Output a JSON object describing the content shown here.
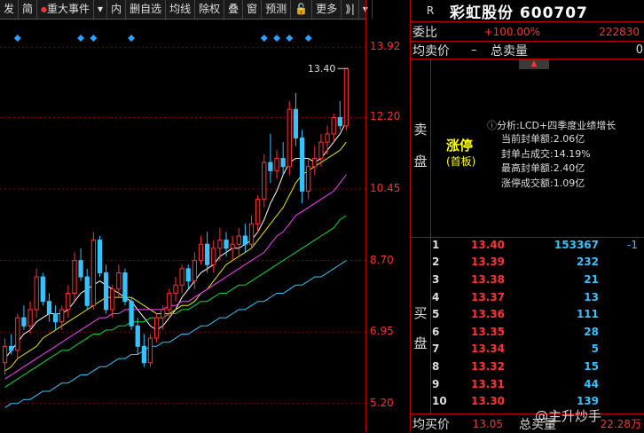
{
  "toolbar": {
    "items": [
      "发",
      "简",
      "重大事件",
      "▾",
      "内",
      "删自选",
      "均线",
      "除权",
      "叠",
      "窗",
      "预测",
      "🔓",
      "更多",
      "⟫|",
      "▾"
    ]
  },
  "chart_data": {
    "type": "candlestick",
    "y_ticks": [
      "13.92",
      "12.20",
      "10.45",
      "8.70",
      "6.95",
      "5.20"
    ],
    "ylim": [
      4.5,
      14.6
    ],
    "last_price_label": "13.40",
    "candles": [
      [
        6.2,
        6.8,
        5.9,
        6.6
      ],
      [
        6.6,
        6.9,
        6.4,
        6.5
      ],
      [
        6.5,
        7.4,
        6.3,
        7.3
      ],
      [
        7.3,
        7.6,
        7.0,
        7.1
      ],
      [
        7.1,
        7.7,
        6.9,
        7.5
      ],
      [
        7.5,
        8.5,
        7.3,
        8.3
      ],
      [
        8.3,
        8.4,
        7.6,
        7.7
      ],
      [
        7.7,
        7.9,
        7.2,
        7.4
      ],
      [
        7.4,
        7.6,
        7.0,
        7.2
      ],
      [
        7.2,
        7.6,
        7.0,
        7.5
      ],
      [
        7.5,
        8.1,
        7.3,
        7.9
      ],
      [
        7.9,
        8.9,
        7.7,
        8.7
      ],
      [
        8.7,
        9.0,
        8.2,
        8.3
      ],
      [
        8.3,
        8.5,
        7.5,
        7.6
      ],
      [
        7.6,
        9.4,
        7.5,
        9.2
      ],
      [
        9.2,
        9.3,
        8.3,
        8.4
      ],
      [
        8.4,
        8.6,
        7.4,
        7.5
      ],
      [
        7.5,
        8.1,
        7.3,
        8.0
      ],
      [
        8.0,
        8.6,
        7.8,
        8.4
      ],
      [
        8.4,
        8.5,
        7.6,
        7.7
      ],
      [
        7.7,
        7.8,
        7.0,
        7.1
      ],
      [
        7.1,
        7.3,
        6.4,
        6.6
      ],
      [
        6.6,
        6.9,
        6.1,
        6.2
      ],
      [
        6.2,
        6.9,
        6.1,
        6.8
      ],
      [
        6.8,
        7.4,
        6.7,
        7.3
      ],
      [
        7.3,
        7.6,
        7.0,
        7.5
      ],
      [
        7.5,
        8.0,
        7.3,
        7.9
      ],
      [
        7.9,
        8.3,
        7.7,
        8.1
      ],
      [
        8.1,
        8.6,
        7.9,
        8.5
      ],
      [
        8.5,
        8.6,
        8.0,
        8.2
      ],
      [
        8.2,
        8.9,
        8.0,
        8.7
      ],
      [
        8.7,
        9.3,
        8.6,
        9.1
      ],
      [
        9.1,
        9.4,
        8.4,
        8.6
      ],
      [
        8.6,
        9.2,
        8.4,
        9.0
      ],
      [
        9.0,
        9.5,
        8.7,
        9.2
      ],
      [
        9.2,
        9.4,
        8.8,
        9.0
      ],
      [
        9.0,
        9.3,
        8.7,
        9.1
      ],
      [
        9.1,
        9.5,
        8.8,
        9.3
      ],
      [
        9.3,
        9.6,
        8.9,
        9.1
      ],
      [
        9.1,
        9.8,
        9.0,
        9.6
      ],
      [
        9.6,
        10.3,
        9.4,
        10.2
      ],
      [
        10.2,
        11.3,
        10.0,
        11.1
      ],
      [
        11.1,
        11.8,
        10.6,
        10.9
      ],
      [
        10.9,
        11.4,
        10.7,
        11.2
      ],
      [
        11.2,
        11.6,
        10.8,
        11.0
      ],
      [
        11.0,
        12.6,
        10.8,
        12.4
      ],
      [
        12.4,
        12.8,
        11.5,
        11.7
      ],
      [
        11.7,
        11.9,
        10.1,
        10.4
      ],
      [
        10.4,
        11.2,
        10.2,
        11.0
      ],
      [
        11.0,
        11.5,
        10.8,
        11.2
      ],
      [
        11.2,
        11.8,
        11.0,
        11.6
      ],
      [
        11.6,
        12.0,
        11.3,
        11.8
      ],
      [
        11.8,
        12.3,
        11.6,
        12.2
      ],
      [
        12.2,
        12.6,
        11.9,
        12.0
      ],
      [
        12.0,
        13.4,
        11.9,
        13.4
      ]
    ],
    "ma_lines": [
      {
        "color": "#ffffff",
        "values": [
          6.3,
          6.5,
          6.7,
          6.9,
          7.0,
          7.2,
          7.3,
          7.4,
          7.4,
          7.4,
          7.5,
          7.7,
          7.9,
          8.0,
          8.1,
          8.2,
          8.1,
          8.0,
          7.9,
          7.8,
          7.7,
          7.5,
          7.3,
          7.1,
          7.0,
          7.1,
          7.3,
          7.5,
          7.8,
          8.0,
          8.2,
          8.4,
          8.5,
          8.6,
          8.8,
          8.9,
          9.0,
          9.0,
          9.1,
          9.2,
          9.4,
          9.7,
          10.1,
          10.4,
          10.8,
          11.1,
          11.2,
          11.2,
          11.2,
          11.1,
          11.2,
          11.4,
          11.6,
          11.8,
          12.1
        ]
      },
      {
        "color": "#e8e800",
        "values": [
          6.0,
          6.1,
          6.3,
          6.4,
          6.5,
          6.6,
          6.8,
          6.9,
          7.0,
          7.1,
          7.2,
          7.3,
          7.4,
          7.5,
          7.6,
          7.7,
          7.8,
          7.8,
          7.8,
          7.8,
          7.8,
          7.7,
          7.6,
          7.5,
          7.4,
          7.4,
          7.4,
          7.5,
          7.6,
          7.6,
          7.7,
          7.9,
          8.0,
          8.2,
          8.4,
          8.6,
          8.7,
          8.8,
          8.9,
          9.0,
          9.2,
          9.4,
          9.6,
          9.8,
          10.0,
          10.3,
          10.6,
          10.8,
          10.9,
          11.0,
          11.1,
          11.2,
          11.3,
          11.4,
          11.6
        ]
      },
      {
        "color": "#ff40ff",
        "values": [
          5.8,
          5.9,
          6.0,
          6.1,
          6.2,
          6.3,
          6.4,
          6.5,
          6.6,
          6.7,
          6.8,
          6.9,
          7.0,
          7.1,
          7.2,
          7.3,
          7.3,
          7.4,
          7.4,
          7.5,
          7.5,
          7.5,
          7.5,
          7.5,
          7.5,
          7.5,
          7.6,
          7.6,
          7.7,
          7.7,
          7.8,
          7.9,
          8.0,
          8.1,
          8.2,
          8.3,
          8.4,
          8.5,
          8.6,
          8.7,
          8.8,
          8.9,
          9.1,
          9.3,
          9.4,
          9.6,
          9.8,
          9.9,
          10.0,
          10.1,
          10.2,
          10.3,
          10.4,
          10.6,
          10.8
        ]
      },
      {
        "color": "#00e040",
        "values": [
          5.6,
          5.7,
          5.8,
          5.9,
          6.0,
          6.1,
          6.2,
          6.3,
          6.4,
          6.5,
          6.5,
          6.6,
          6.7,
          6.8,
          6.9,
          6.9,
          7.0,
          7.0,
          7.1,
          7.1,
          7.2,
          7.2,
          7.2,
          7.3,
          7.3,
          7.3,
          7.4,
          7.4,
          7.5,
          7.5,
          7.6,
          7.7,
          7.7,
          7.8,
          7.9,
          7.9,
          8.0,
          8.1,
          8.1,
          8.2,
          8.3,
          8.4,
          8.5,
          8.6,
          8.7,
          8.8,
          8.9,
          9.0,
          9.1,
          9.2,
          9.3,
          9.4,
          9.5,
          9.7,
          9.8
        ]
      },
      {
        "color": "#30c8ff",
        "values": [
          5.1,
          5.2,
          5.2,
          5.3,
          5.3,
          5.4,
          5.5,
          5.5,
          5.6,
          5.7,
          5.7,
          5.8,
          5.9,
          5.9,
          6.0,
          6.1,
          6.1,
          6.2,
          6.3,
          6.3,
          6.4,
          6.4,
          6.5,
          6.6,
          6.6,
          6.7,
          6.7,
          6.8,
          6.9,
          6.9,
          7.0,
          7.1,
          7.1,
          7.2,
          7.3,
          7.3,
          7.4,
          7.5,
          7.5,
          7.6,
          7.7,
          7.7,
          7.8,
          7.9,
          7.9,
          8.0,
          8.1,
          8.1,
          8.2,
          8.3,
          8.3,
          8.4,
          8.5,
          8.6,
          8.7
        ]
      }
    ],
    "diamond_marker_indices": [
      2,
      12,
      14,
      20,
      41,
      43,
      45,
      48
    ]
  },
  "panel": {
    "market_tag": "R",
    "stock_name": "彩虹股份 600707",
    "weibi_label": "委比",
    "weibi_value": "+100.00%",
    "weibi_count": "222830",
    "avg_sell_label": "均卖价",
    "avg_sell_value": "–",
    "total_sell_label": "总卖量",
    "total_sell_value": "0",
    "sell_side_label": [
      "卖",
      "盘"
    ],
    "limit_up": "涨停",
    "first_board": "(首板)",
    "analysis_title": "分析:LCD+四季度业绩增长",
    "analysis_lines": [
      "当前封单额:2.06亿",
      "封单占成交:14.19%",
      "最高封单额:2.40亿",
      "涨停成交额:1.09亿"
    ],
    "buy_side_label": [
      "买",
      "盘"
    ],
    "buy_rows": [
      {
        "n": "1",
        "p": "13.40",
        "v": "153367",
        "c": "-1"
      },
      {
        "n": "2",
        "p": "13.39",
        "v": "232",
        "c": ""
      },
      {
        "n": "3",
        "p": "13.38",
        "v": "21",
        "c": ""
      },
      {
        "n": "4",
        "p": "13.37",
        "v": "13",
        "c": ""
      },
      {
        "n": "5",
        "p": "13.36",
        "v": "111",
        "c": ""
      },
      {
        "n": "6",
        "p": "13.35",
        "v": "28",
        "c": ""
      },
      {
        "n": "7",
        "p": "13.34",
        "v": "5",
        "c": ""
      },
      {
        "n": "8",
        "p": "13.32",
        "v": "15",
        "c": ""
      },
      {
        "n": "9",
        "p": "13.31",
        "v": "44",
        "c": ""
      },
      {
        "n": "10",
        "p": "13.30",
        "v": "139",
        "c": ""
      }
    ],
    "avg_buy_label": "均买价",
    "avg_buy_value": "13.05",
    "total_buy_label": "总买量",
    "total_buy_value": "22.28万"
  },
  "watermark": "@主升炒手",
  "colors": {
    "up": "#ff3333",
    "down": "#36c2ff",
    "grid": "#b00000"
  }
}
